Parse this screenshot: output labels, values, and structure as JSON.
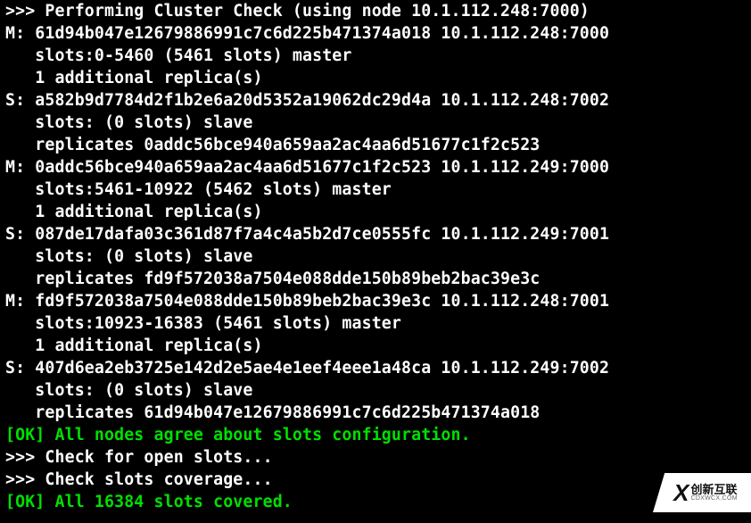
{
  "header_line": ">>> Performing Cluster Check (using node 10.1.112.248:7000)",
  "nodes": [
    {
      "role": "M",
      "id": "61d94b047e12679886991c7c6d225b471374a018",
      "addr": "10.1.112.248:7000",
      "slots_line": "   slots:0-5460 (5461 slots) master",
      "extra_line": "   1 additional replica(s)"
    },
    {
      "role": "S",
      "id": "a582b9d7784d2f1b2e6a20d5352a19062dc29d4a",
      "addr": "10.1.112.248:7002",
      "slots_line": "   slots: (0 slots) slave",
      "extra_line": "   replicates 0addc56bce940a659aa2ac4aa6d51677c1f2c523"
    },
    {
      "role": "M",
      "id": "0addc56bce940a659aa2ac4aa6d51677c1f2c523",
      "addr": "10.1.112.249:7000",
      "slots_line": "   slots:5461-10922 (5462 slots) master",
      "extra_line": "   1 additional replica(s)"
    },
    {
      "role": "S",
      "id": "087de17dafa03c361d87f7a4c4a5b2d7ce0555fc",
      "addr": "10.1.112.249:7001",
      "slots_line": "   slots: (0 slots) slave",
      "extra_line": "   replicates fd9f572038a7504e088dde150b89beb2bac39e3c"
    },
    {
      "role": "M",
      "id": "fd9f572038a7504e088dde150b89beb2bac39e3c",
      "addr": "10.1.112.248:7001",
      "slots_line": "   slots:10923-16383 (5461 slots) master",
      "extra_line": "   1 additional replica(s)"
    },
    {
      "role": "S",
      "id": "407d6ea2eb3725e142d2e5ae4e1eef4eee1a48ca",
      "addr": "10.1.112.249:7002",
      "slots_line": "   slots: (0 slots) slave",
      "extra_line": "   replicates 61d94b047e12679886991c7c6d225b471374a018"
    }
  ],
  "ok_config": "[OK] All nodes agree about slots configuration.",
  "check_open": ">>> Check for open slots...",
  "check_coverage": ">>> Check slots coverage...",
  "ok_covered": "[OK] All 16384 slots covered.",
  "watermark": {
    "cn": "创新互联",
    "en": "CDXWCX.COM",
    "x": "X"
  }
}
